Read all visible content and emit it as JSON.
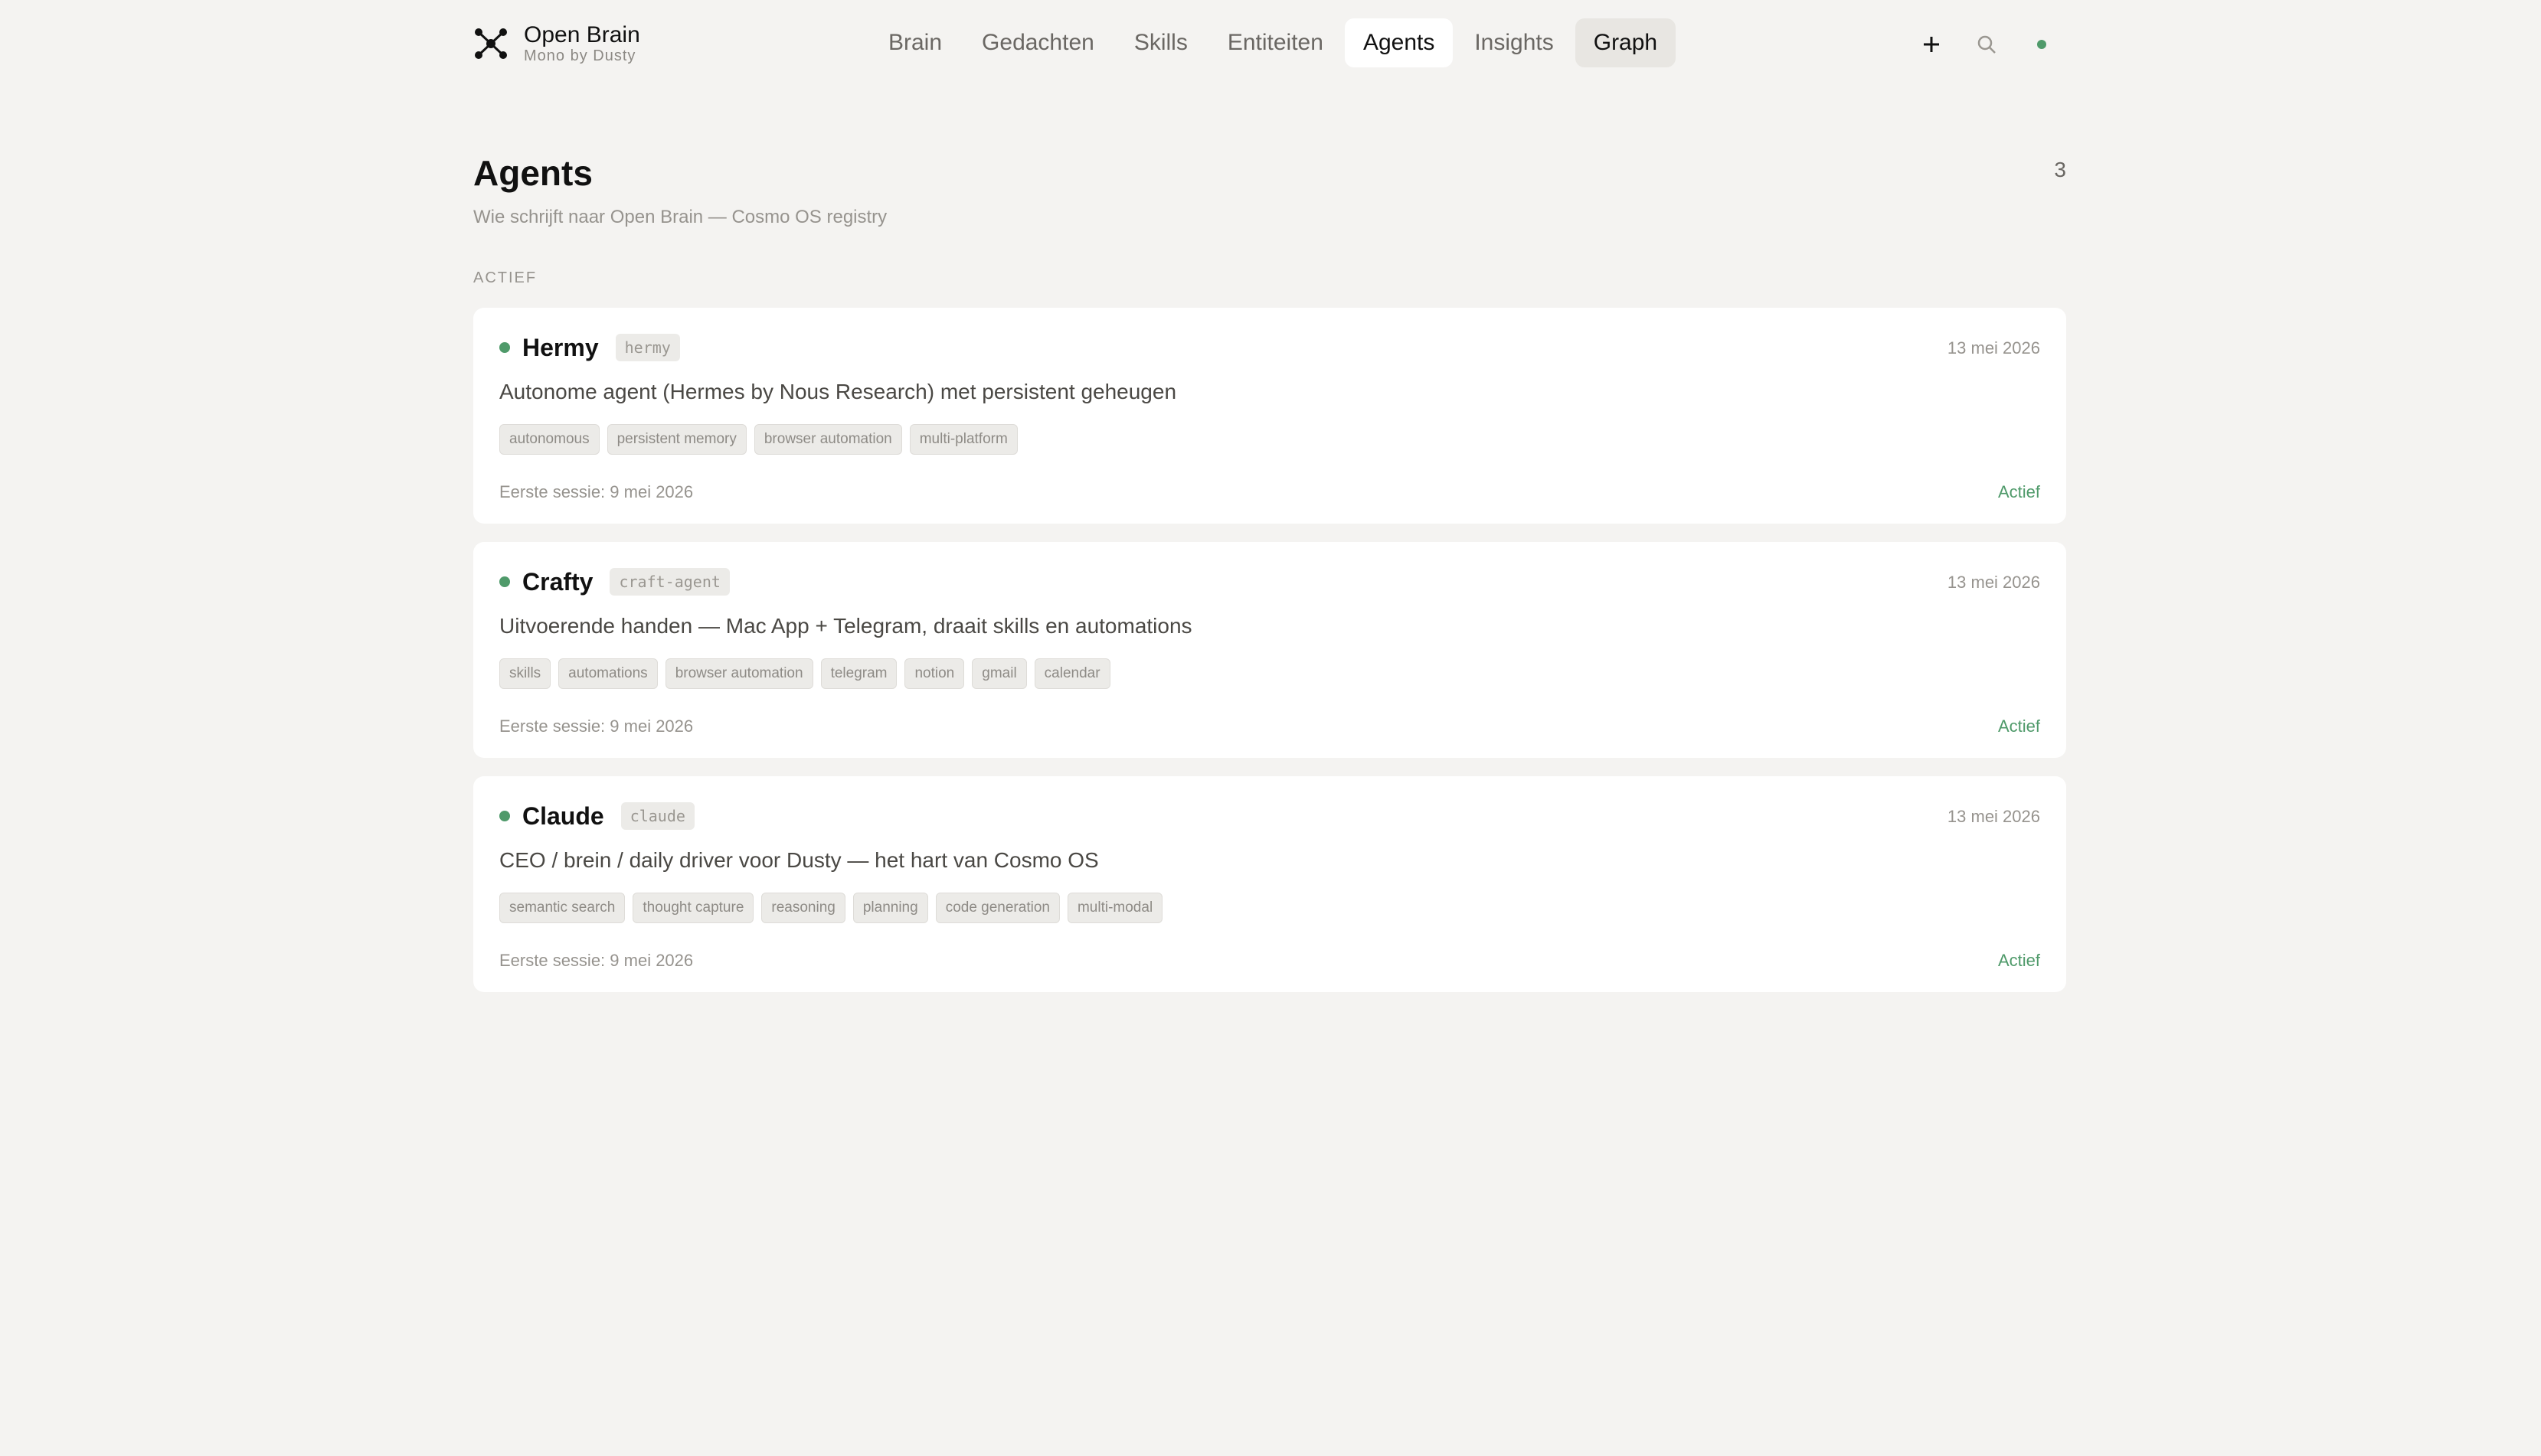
{
  "brand": {
    "name": "Open Brain",
    "subtitle": "Mono by Dusty",
    "logo_icon": "network-nodes-icon"
  },
  "nav": {
    "items": [
      {
        "label": "Brain",
        "state": "default"
      },
      {
        "label": "Gedachten",
        "state": "default"
      },
      {
        "label": "Skills",
        "state": "default"
      },
      {
        "label": "Entiteiten",
        "state": "default"
      },
      {
        "label": "Agents",
        "state": "active"
      },
      {
        "label": "Insights",
        "state": "default"
      },
      {
        "label": "Graph",
        "state": "hover"
      }
    ]
  },
  "actions": {
    "add_icon": "plus-icon",
    "search_icon": "search-icon",
    "status_icon": "status-dot-icon"
  },
  "page": {
    "title": "Agents",
    "count": "3",
    "subtitle": "Wie schrijft naar Open Brain — Cosmo OS registry",
    "section_label": "ACTIEF"
  },
  "colors": {
    "background": "#f4f3f1",
    "card": "#ffffff",
    "accent_green": "#4f9a6a"
  },
  "agents": [
    {
      "name": "Hermy",
      "slug": "hermy",
      "date": "13 mei 2026",
      "description": "Autonome agent (Hermes by Nous Research) met persistent geheugen",
      "tags": [
        "autonomous",
        "persistent memory",
        "browser automation",
        "multi-platform"
      ],
      "first_session": "Eerste sessie: 9 mei 2026",
      "status": "Actief"
    },
    {
      "name": "Crafty",
      "slug": "craft-agent",
      "date": "13 mei 2026",
      "description": "Uitvoerende handen — Mac App + Telegram, draait skills en automations",
      "tags": [
        "skills",
        "automations",
        "browser automation",
        "telegram",
        "notion",
        "gmail",
        "calendar"
      ],
      "first_session": "Eerste sessie: 9 mei 2026",
      "status": "Actief"
    },
    {
      "name": "Claude",
      "slug": "claude",
      "date": "13 mei 2026",
      "description": "CEO / brein / daily driver voor Dusty — het hart van Cosmo OS",
      "tags": [
        "semantic search",
        "thought capture",
        "reasoning",
        "planning",
        "code generation",
        "multi-modal"
      ],
      "first_session": "Eerste sessie: 9 mei 2026",
      "status": "Actief"
    }
  ]
}
